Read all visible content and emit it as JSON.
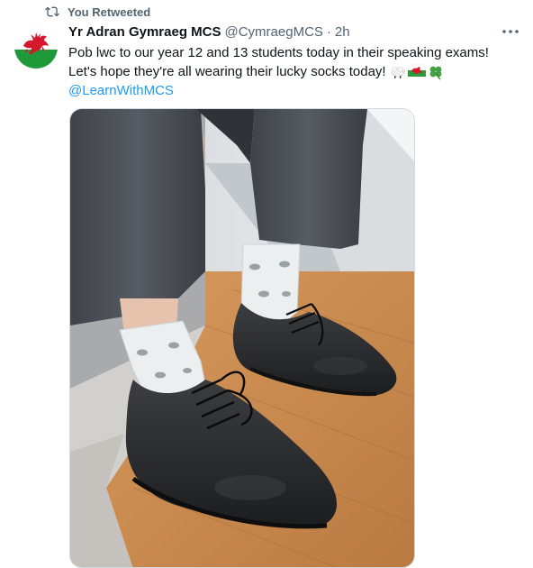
{
  "retweet": {
    "icon": "retweet-icon",
    "label": "You Retweeted"
  },
  "tweet": {
    "avatar_icon": "welsh-dragon-flag-avatar",
    "display_name": "Yr Adran Gymraeg MCS",
    "handle": "@CymraegMCS",
    "separator": "·",
    "time": "2h",
    "text_line1": "Pob lwc to our year 12 and 13 students today in their speaking exams!",
    "text_line2": "Let's hope they're all wearing their lucky socks today!",
    "emojis": [
      "sheep-emoji",
      "welsh-flag-emoji",
      "four-leaf-clover-emoji"
    ],
    "mention": "@LearnWithMCS",
    "more_icon": "more-horizontal-icon",
    "media_description_icon": "photo-image"
  },
  "colors": {
    "text_primary": "#0f1419",
    "text_secondary": "#536471",
    "link": "#1d9bf0",
    "border": "#cfd9de"
  }
}
